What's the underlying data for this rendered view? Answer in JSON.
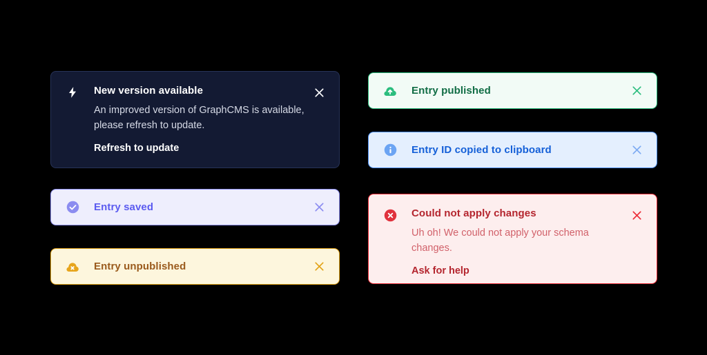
{
  "theme": {
    "page_background": "#000000",
    "update_bg": "#131a33",
    "update_border": "#273358",
    "saved_bg": "#eeeefd",
    "saved_border": "#8b8cf0",
    "saved_text": "#5b5bf0",
    "unpublished_bg": "#fdf6dd",
    "unpublished_border": "#e2a317",
    "unpublished_text": "#9a5a1c",
    "published_bg": "#f2fbf6",
    "published_border": "#2bbd7e",
    "published_text": "#116d45",
    "copied_bg": "#e4effe",
    "copied_border": "#4a8ef0",
    "copied_text": "#1560d8",
    "error_bg": "#fdeeee",
    "error_border": "#ec2b36",
    "error_text": "#b4252e",
    "error_message_text": "#d1616a"
  },
  "toasts": {
    "update": {
      "icon": "lightning-bolt-icon",
      "title": "New version available",
      "message": "An improved version of GraphCMS is available, please refresh to update.",
      "action": "Refresh to update",
      "close": "close-icon"
    },
    "saved": {
      "icon": "check-circle-icon",
      "title": "Entry saved",
      "close": "close-icon"
    },
    "unpublished": {
      "icon": "cloud-x-icon",
      "title": "Entry unpublished",
      "close": "close-icon"
    },
    "published": {
      "icon": "cloud-upload-icon",
      "title": "Entry published",
      "close": "close-icon"
    },
    "copied": {
      "icon": "info-circle-icon",
      "title": "Entry ID copied to clipboard",
      "close": "close-icon"
    },
    "error": {
      "icon": "error-circle-icon",
      "title": "Could not apply changes",
      "message": "Uh oh! We could not apply your schema changes.",
      "action": "Ask for help",
      "close": "close-icon"
    }
  }
}
